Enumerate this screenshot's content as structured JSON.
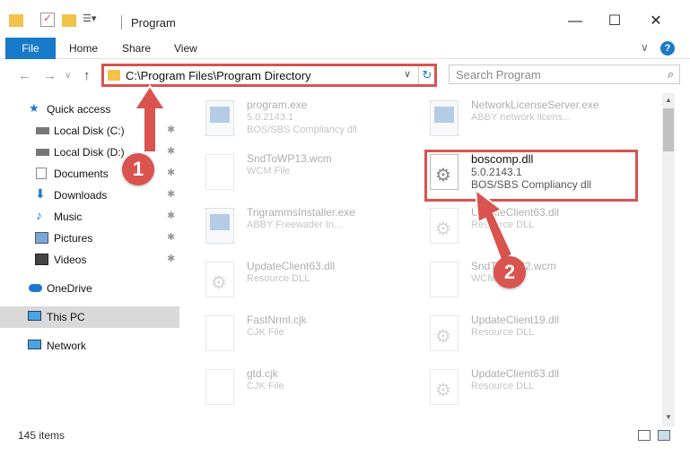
{
  "window": {
    "title": "Program",
    "minimize": "—",
    "maximize": "☐",
    "close": "✕"
  },
  "ribbon": {
    "file_tab": "File",
    "tabs": [
      "Home",
      "Share",
      "View"
    ],
    "help": "?",
    "expand": "∨"
  },
  "address": {
    "back": "←",
    "forward": "→",
    "recent": "∨",
    "up": "↑",
    "path": "C:\\Program Files\\Program Directory",
    "dropdown": "∨",
    "refresh": "↻"
  },
  "search": {
    "placeholder": "Search Program",
    "icon": "⌕"
  },
  "sidebar": {
    "items": [
      {
        "label": "Quick access"
      },
      {
        "label": "Local Disk (C:)"
      },
      {
        "label": "Local Disk (D:)"
      },
      {
        "label": "Documents"
      },
      {
        "label": "Downloads"
      },
      {
        "label": "Music"
      },
      {
        "label": "Pictures"
      },
      {
        "label": "Videos"
      },
      {
        "label": "OneDrive"
      },
      {
        "label": "This PC"
      },
      {
        "label": "Network"
      }
    ],
    "pin": "✱"
  },
  "files": [
    {
      "name": "program.exe",
      "line2": "5.0.2143.1",
      "line3": "BOS/SBS Compliancy dll"
    },
    {
      "name": "NetworkLicenseServer.exe",
      "line2": "ABBY network licens..."
    },
    {
      "name": "SndToWP13.wcm",
      "line2": "WCM File"
    },
    {
      "name": "boscomp.dll",
      "line2": "5.0.2143.1",
      "line3": "BOS/SBS Compliancy dll"
    },
    {
      "name": "TrigrammsInstaller.exe",
      "line2": "ABBY Freewader In..."
    },
    {
      "name": "UpdateClient63.dll",
      "line2": "Resource DLL"
    },
    {
      "name": "UpdateClient63.dll",
      "line2": "Resource DLL"
    },
    {
      "name": "SndToWP32.wcm",
      "line2": "WCM File"
    },
    {
      "name": "FastNrml.cjk",
      "line2": "CJK File"
    },
    {
      "name": "UpdateClient19.dll",
      "line2": "Resource DLL"
    },
    {
      "name": "gtd.cjk",
      "line2": "CJK File"
    },
    {
      "name": "UpdateClient63.dll",
      "line2": "Resource DLL"
    }
  ],
  "status": {
    "count": "145 items"
  },
  "annotations": {
    "step1": "1",
    "step2": "2"
  },
  "colors": {
    "accent": "#1979ca",
    "highlight": "#d9534f"
  }
}
